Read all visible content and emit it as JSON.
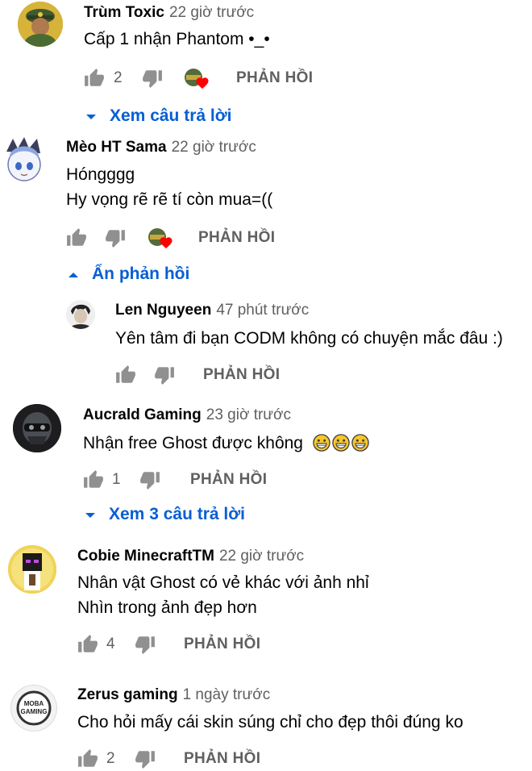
{
  "reply_label": "PHẢN HỒI",
  "comments": [
    {
      "author": "Trùm Toxic",
      "time": "22 giờ trước",
      "lines": [
        "Cấp 1 nhận Phantom •_•"
      ],
      "likes": "2",
      "creator_heart": true
    },
    {
      "toggle": "Xem câu trả lời"
    },
    {
      "author": "Mèo HT Sama",
      "time": "22 giờ trước",
      "lines": [
        "Hóngggg",
        "Hy vọng rẽ rẽ tí còn mua=(("
      ],
      "likes": "",
      "creator_heart": true
    },
    {
      "toggle": "Ẩn phản hồi"
    },
    {
      "author": "Len Nguyeen",
      "time": "47 phút trước",
      "lines": [
        "Yên tâm đi bạn CODM không có chuyện mắc đâu :)"
      ],
      "likes": ""
    },
    {
      "author": "Aucrald Gaming",
      "time": "23 giờ trước",
      "lines": [
        "Nhận free Ghost được không"
      ],
      "emoji": "grinning-face-x3",
      "likes": "1"
    },
    {
      "toggle": "Xem 3 câu trả lời"
    },
    {
      "author": "Cobie MinecraftTM",
      "time": "22 giờ trước",
      "lines": [
        "Nhân vật Ghost có vẻ khác với ảnh nhỉ",
        "Nhìn trong ảnh đẹp hơn"
      ],
      "likes": "4"
    },
    {
      "author": "Zerus gaming",
      "time": "1 ngày trước",
      "avatar_text": [
        "MOBA",
        "GAMING"
      ],
      "lines": [
        "Cho hỏi mấy cái skin súng chỉ cho đẹp thôi đúng ko"
      ],
      "likes": "2"
    }
  ]
}
